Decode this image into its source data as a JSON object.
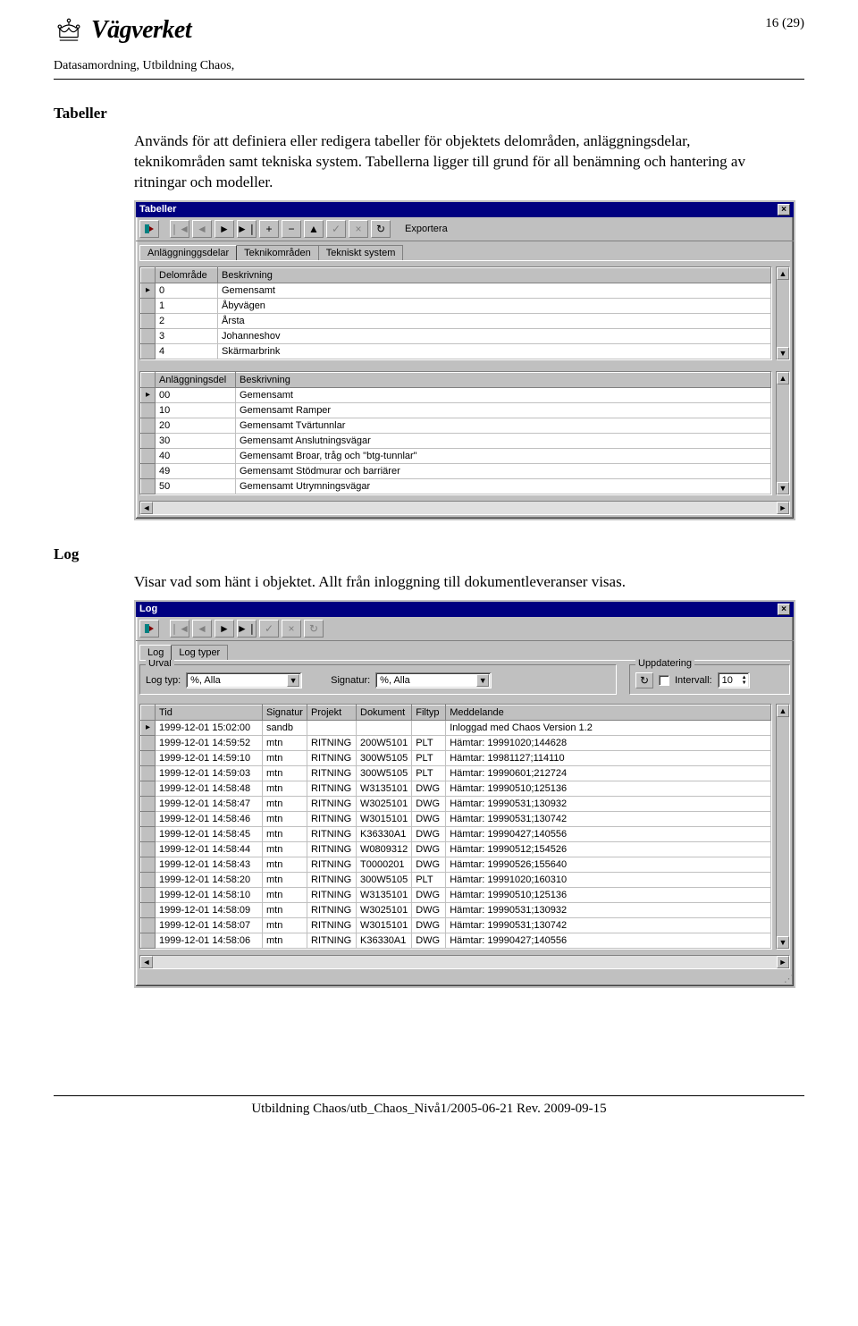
{
  "header": {
    "brand": "Vägverket",
    "page_num": "16 (29)",
    "subtitle": "Datasamordning, Utbildning Chaos,"
  },
  "section1": {
    "title": "Tabeller",
    "text": "Används för att definiera eller redigera tabeller för objektets delområden, anläggningsdelar, teknikområden samt tekniska system. Tabellerna ligger till grund för all benämning och hantering av ritningar och modeller."
  },
  "win1": {
    "title": "Tabeller",
    "export_label": "Exportera",
    "tabs": [
      "Anläggninggsdelar",
      "Teknikområden",
      "Tekniskt system"
    ],
    "grid1_headers": [
      "Delområde",
      "Beskrivning"
    ],
    "grid1_rows": [
      [
        "0",
        "Gemensamt"
      ],
      [
        "1",
        "Åbyvägen"
      ],
      [
        "2",
        "Årsta"
      ],
      [
        "3",
        "Johanneshov"
      ],
      [
        "4",
        "Skärmarbrink"
      ]
    ],
    "grid2_headers": [
      "Anläggningsdel",
      "Beskrivning"
    ],
    "grid2_rows": [
      [
        "00",
        "Gemensamt"
      ],
      [
        "10",
        "Gemensamt Ramper"
      ],
      [
        "20",
        "Gemensamt Tvärtunnlar"
      ],
      [
        "30",
        "Gemensamt Anslutningsvägar"
      ],
      [
        "40",
        "Gemensamt Broar, tråg och \"btg-tunnlar\""
      ],
      [
        "49",
        "Gemensamt Stödmurar och barriärer"
      ],
      [
        "50",
        "Gemensamt Utrymningsvägar"
      ]
    ]
  },
  "section2": {
    "title": "Log",
    "text": "Visar vad som hänt i objektet. Allt från inloggning till dokumentleveranser visas."
  },
  "win2": {
    "title": "Log",
    "tabs": [
      "Log",
      "Log typer"
    ],
    "urval_legend": "Urval",
    "logtyp_label": "Log typ:",
    "logtyp_value": "%, Alla",
    "signatur_label": "Signatur:",
    "signatur_value": "%, Alla",
    "upd_legend": "Uppdatering",
    "intervall_label": "Intervall:",
    "intervall_value": "10",
    "grid_headers": [
      "Tid",
      "Signatur",
      "Projekt",
      "Dokument",
      "Filtyp",
      "Meddelande"
    ],
    "grid_rows": [
      [
        "1999-12-01 15:02:00",
        "sandb",
        "",
        "",
        "",
        "Inloggad med Chaos Version 1.2"
      ],
      [
        "1999-12-01 14:59:52",
        "mtn",
        "RITNING",
        "200W5101",
        "PLT",
        "Hämtar: 19991020;144628"
      ],
      [
        "1999-12-01 14:59:10",
        "mtn",
        "RITNING",
        "300W5105",
        "PLT",
        "Hämtar: 19981127;114110"
      ],
      [
        "1999-12-01 14:59:03",
        "mtn",
        "RITNING",
        "300W5105",
        "PLT",
        "Hämtar: 19990601;212724"
      ],
      [
        "1999-12-01 14:58:48",
        "mtn",
        "RITNING",
        "W3135101",
        "DWG",
        "Hämtar: 19990510;125136"
      ],
      [
        "1999-12-01 14:58:47",
        "mtn",
        "RITNING",
        "W3025101",
        "DWG",
        "Hämtar: 19990531;130932"
      ],
      [
        "1999-12-01 14:58:46",
        "mtn",
        "RITNING",
        "W3015101",
        "DWG",
        "Hämtar: 19990531;130742"
      ],
      [
        "1999-12-01 14:58:45",
        "mtn",
        "RITNING",
        "K36330A1",
        "DWG",
        "Hämtar: 19990427;140556"
      ],
      [
        "1999-12-01 14:58:44",
        "mtn",
        "RITNING",
        "W0809312",
        "DWG",
        "Hämtar: 19990512;154526"
      ],
      [
        "1999-12-01 14:58:43",
        "mtn",
        "RITNING",
        "T0000201",
        "DWG",
        "Hämtar: 19990526;155640"
      ],
      [
        "1999-12-01 14:58:20",
        "mtn",
        "RITNING",
        "300W5105",
        "PLT",
        "Hämtar: 19991020;160310"
      ],
      [
        "1999-12-01 14:58:10",
        "mtn",
        "RITNING",
        "W3135101",
        "DWG",
        "Hämtar: 19990510;125136"
      ],
      [
        "1999-12-01 14:58:09",
        "mtn",
        "RITNING",
        "W3025101",
        "DWG",
        "Hämtar: 19990531;130932"
      ],
      [
        "1999-12-01 14:58:07",
        "mtn",
        "RITNING",
        "W3015101",
        "DWG",
        "Hämtar: 19990531;130742"
      ],
      [
        "1999-12-01 14:58:06",
        "mtn",
        "RITNING",
        "K36330A1",
        "DWG",
        "Hämtar: 19990427;140556"
      ]
    ]
  },
  "footer": "Utbildning Chaos/utb_Chaos_Nivå1/2005-06-21 Rev. 2009-09-15"
}
